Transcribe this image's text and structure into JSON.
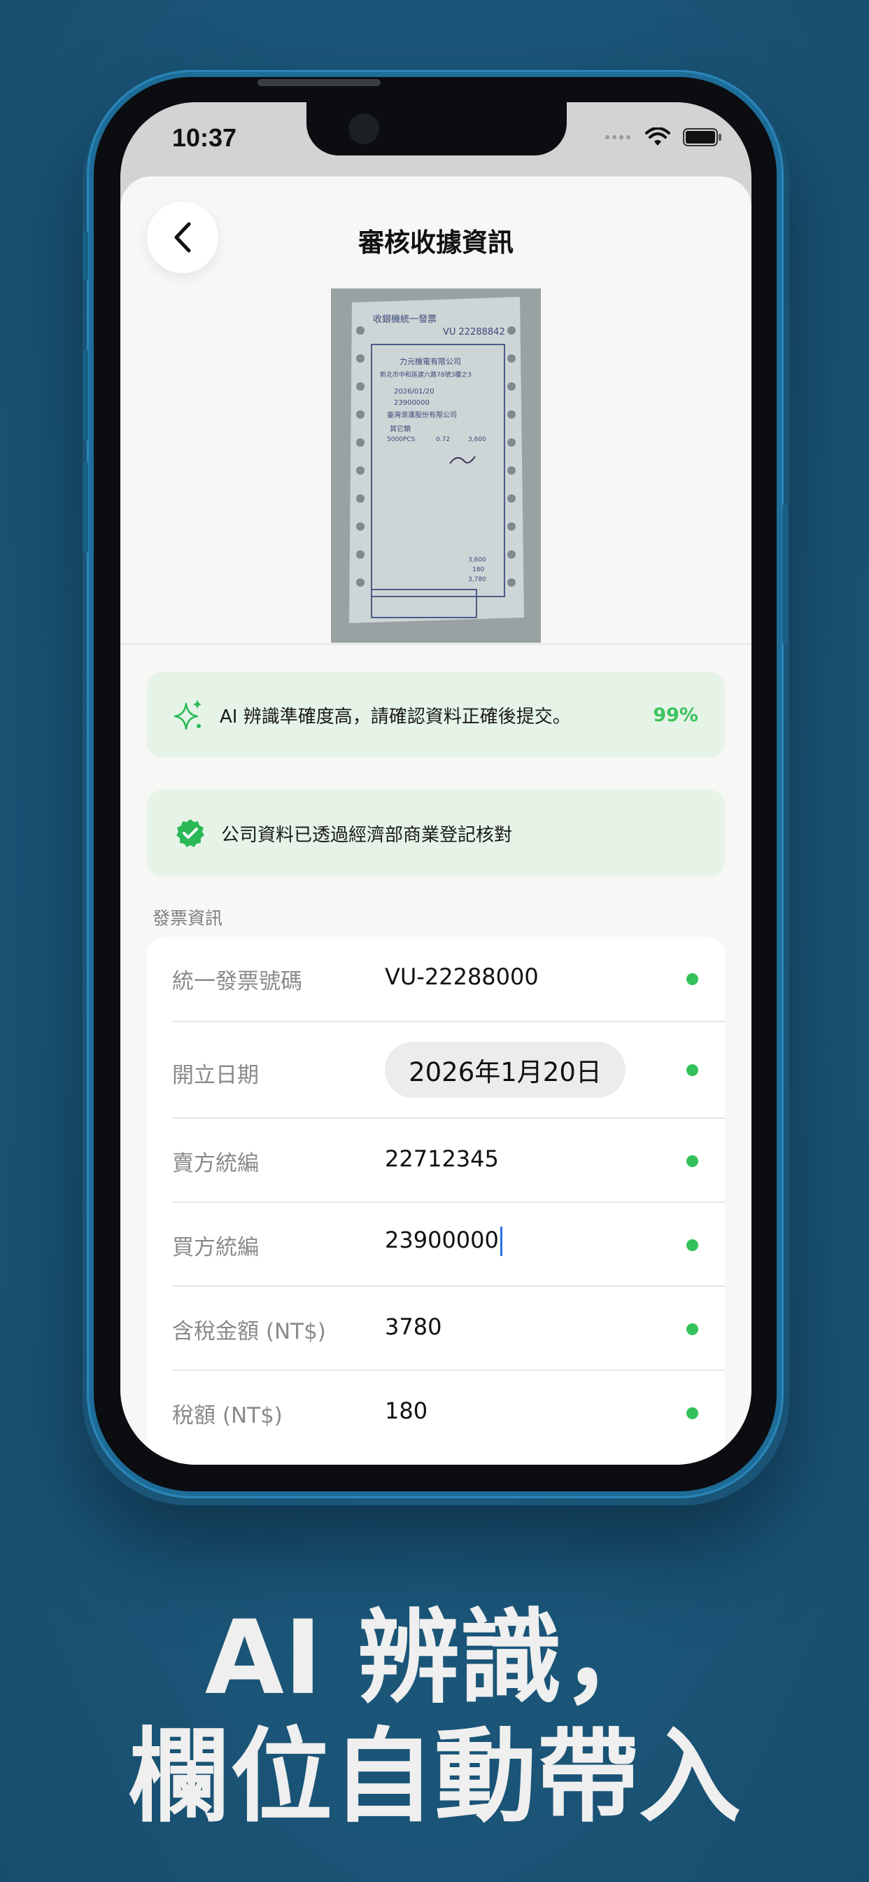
{
  "status_bar": {
    "time": "10:37"
  },
  "header": {
    "title": "審核收據資訊"
  },
  "receipt_image": {
    "header_text": "收銀機統一發票",
    "invoice_no": "VU 22288842",
    "company": "力元機電有限公司",
    "address": "新北市中和區建六路78號3樓之3",
    "date": "2026/01/20",
    "buyer": "23900000",
    "buyer_company": "臺灣滾運股份有限公司",
    "item": "其它類",
    "item_code": "5000PCS",
    "unit_price": "0.72",
    "amount": "3,600",
    "sales": "3,600",
    "tax": "180",
    "total": "3,780"
  },
  "ai_banner": {
    "icon": "sparkle-icon",
    "text": "AI 辨識準確度高，請確認資料正確後提交。",
    "confidence": "99%"
  },
  "verify_banner": {
    "icon": "check-badge-icon",
    "text": "公司資料已透過經濟部商業登記核對"
  },
  "section": {
    "title": "發票資訊"
  },
  "fields": [
    {
      "label": "統一發票號碼",
      "value": "VU-22288000"
    },
    {
      "label": "開立日期",
      "value": "2026年1月20日"
    },
    {
      "label": "賣方統編",
      "value": "22712345"
    },
    {
      "label": "買方統編",
      "value": "23900000"
    },
    {
      "label": "含稅金額 (NT$)",
      "value": "3780"
    },
    {
      "label": "稅額 (NT$)",
      "value": "180"
    }
  ],
  "headline": {
    "line1": "AI 辨識，",
    "line2": "欄位自動帶入"
  },
  "colors": {
    "background": "#1b5679",
    "accent_green": "#33c25a",
    "banner_green": "#e6f4e8"
  }
}
